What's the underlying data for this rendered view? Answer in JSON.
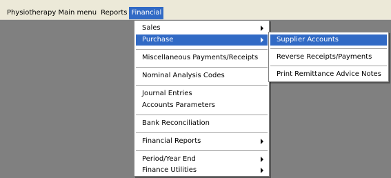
{
  "menubar": {
    "items": [
      {
        "label": "Physiotherapy Main menu"
      },
      {
        "label": "Reports"
      },
      {
        "label": "Financial"
      }
    ]
  },
  "financial_menu": {
    "items": [
      {
        "label": "Sales"
      },
      {
        "label": "Purchase"
      },
      {
        "label": "Miscellaneous Payments/Receipts"
      },
      {
        "label": "Nominal Analysis Codes"
      },
      {
        "label": "Journal Entries"
      },
      {
        "label": "Accounts Parameters"
      },
      {
        "label": "Bank Reconciliation"
      },
      {
        "label": "Financial Reports"
      },
      {
        "label": "Period/Year End"
      },
      {
        "label": "Finance Utilities"
      }
    ]
  },
  "purchase_submenu": {
    "items": [
      {
        "label": "Supplier Accounts"
      },
      {
        "label": "Reverse Receipts/Payments"
      },
      {
        "label": "Print Remittance Advice Notes"
      }
    ]
  },
  "colors": {
    "highlight": "#316ac5",
    "menubar_bg": "#ece9d8",
    "workspace_bg": "#808080"
  }
}
